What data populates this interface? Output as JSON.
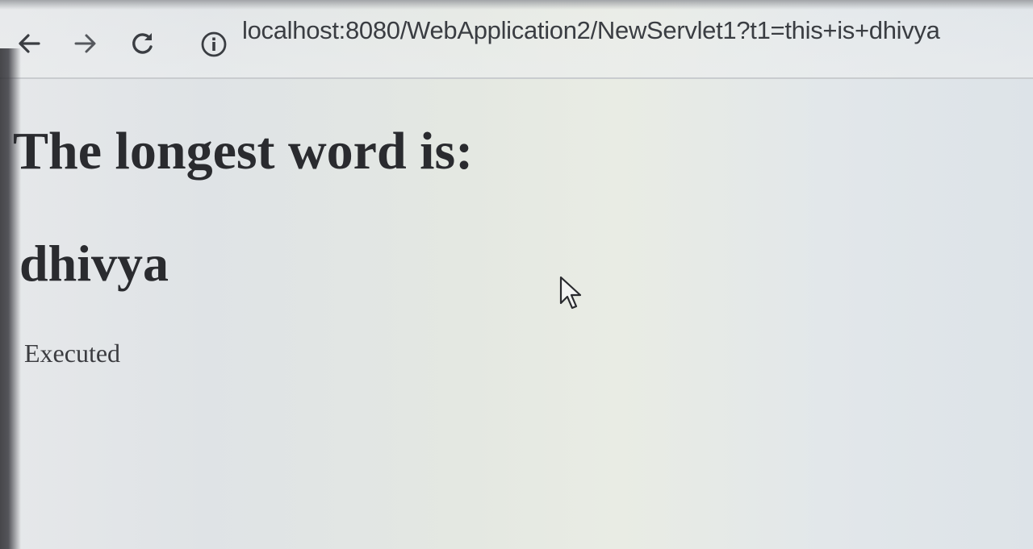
{
  "browser": {
    "address_bar": {
      "url": "localhost:8080/WebApplication2/NewServlet1?t1=this+is+dhivya"
    },
    "icons": {
      "back": "arrow-left-icon",
      "forward": "arrow-right-icon",
      "reload": "reload-icon",
      "info": "info-circle-icon"
    }
  },
  "page": {
    "heading": "The longest word is:",
    "result": "dhivya",
    "status": "Executed"
  },
  "colors": {
    "text": "#2a2b2f",
    "toolbar_icon": "#3a3d42"
  }
}
